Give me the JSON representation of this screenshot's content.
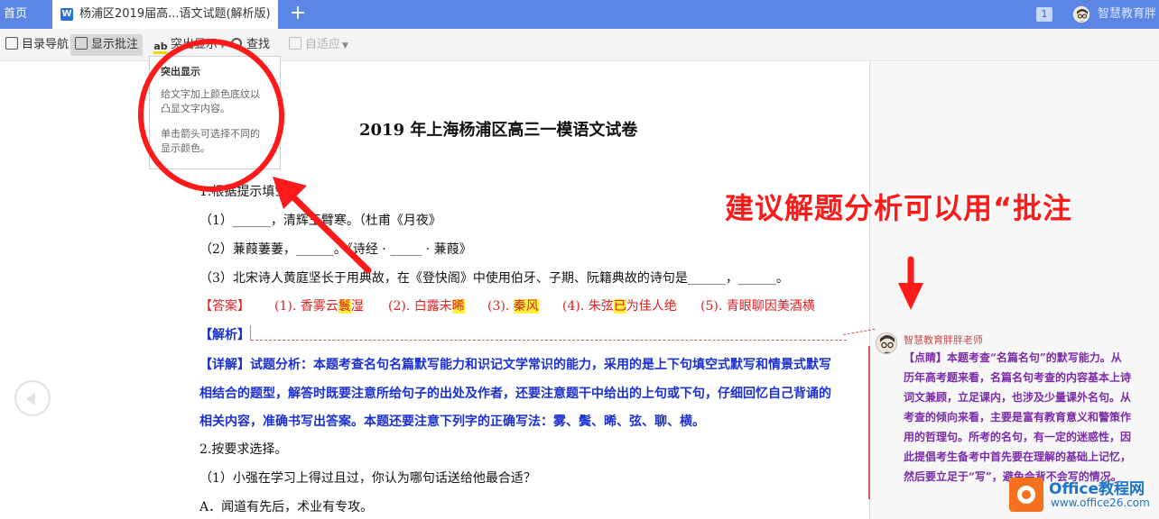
{
  "tabs": {
    "home_label": "首页",
    "doc_label": "杨浦区2019届高...语文试题(解析版)",
    "doc_icon_letter": "W",
    "add_label": "+",
    "badge": "1",
    "user_name": "智慧教育胖"
  },
  "toolbar": {
    "nav_label": "目录导航",
    "comments_label": "显示批注",
    "highlight_label": "突出显示",
    "highlight_icon_text": "ab",
    "find_label": "查找",
    "fit_label": "自适应"
  },
  "tooltip": {
    "title": "突出显示",
    "line1": "给文字加上颜色底纹以",
    "line2": "凸显文字内容。",
    "line3": "单击箭头可选择不同的",
    "line4": "显示颜色。"
  },
  "document": {
    "title": "2019 年上海杨浦区高三一模语文试卷",
    "q1": "1.根据提示填空",
    "q1_1": "（1）______，清辉玉臂寒。（杜甫《月夜》",
    "q1_2": "（2）蒹葭萋萋，______。《诗经 · _____ · 蒹葭》",
    "q1_3": "（3）北宋诗人黄庭坚长于用典故，在《登快阁》中使用伯牙、子期、阮籍典故的诗句是______，______。",
    "answer_label": "【答案】",
    "answers": {
      "a1_pre": "(1). 香雾云",
      "a1_hl": "鬟",
      "a1_post": "湿",
      "a2_pre": "(2). 白露未",
      "a2_hl": "晞",
      "a3_pre": "(3). ",
      "a3_hl": "秦风",
      "a4_pre": "(4). 朱弦",
      "a4_hl": "已",
      "a4_post": "为佳人绝",
      "a5": "(5). 青眼聊因美酒横"
    },
    "analysis_label": "【解析】",
    "detail_1": "【详解】试题分析：本题考查名句名篇默写能力和识记文学常识的能力，采用的是上下句填空式默写和情景式默写",
    "detail_2": "相结合的题型，解答时既要注意所给句子的出处及作者，还要注意题干中给出的上句或下句，仔细回忆自己背诵的",
    "detail_3": "相关内容，准确书写出答案。本题还要注意下列字的正确写法：雾、鬓、晞、弦、聊、横。",
    "q2": "2.按要求选择。",
    "q2_1": "（1）小强在学习上得过且过，你认为哪句话送给他最合适？",
    "q2_a": "A．闻道有先后，术业有专攻。"
  },
  "comment": {
    "author": "智慧教育胖胖老师",
    "lines": [
      "【点睛】本题考查“名篇名句”的默写能力。从",
      "历年高考题来看，名篇名句考查的内容基本上诗",
      "词文兼顾，立足课内，也涉及少量课外名句。从",
      "考查的倾向来看，主要是富有教育意义和警策作",
      "用的哲理句。所考的名句，有一定的迷惑性，因",
      "此提倡考生备考中首先要在理解的基础上记忆，",
      "然后要立足于“写”，避免会背不会写的情况。"
    ]
  },
  "annotation": {
    "text": "建议解题分析可以用“批注"
  },
  "watermark": {
    "brand": "Office教程网",
    "url": "www.office26.com"
  },
  "colors": {
    "tabbar": "#5b86e5",
    "annotation_red": "#ff1a1a",
    "answer_red": "#e02020",
    "analysis_blue": "#1a2fd4",
    "comment_purple": "#7a2ba8",
    "highlight_yellow": "#fff23a"
  }
}
